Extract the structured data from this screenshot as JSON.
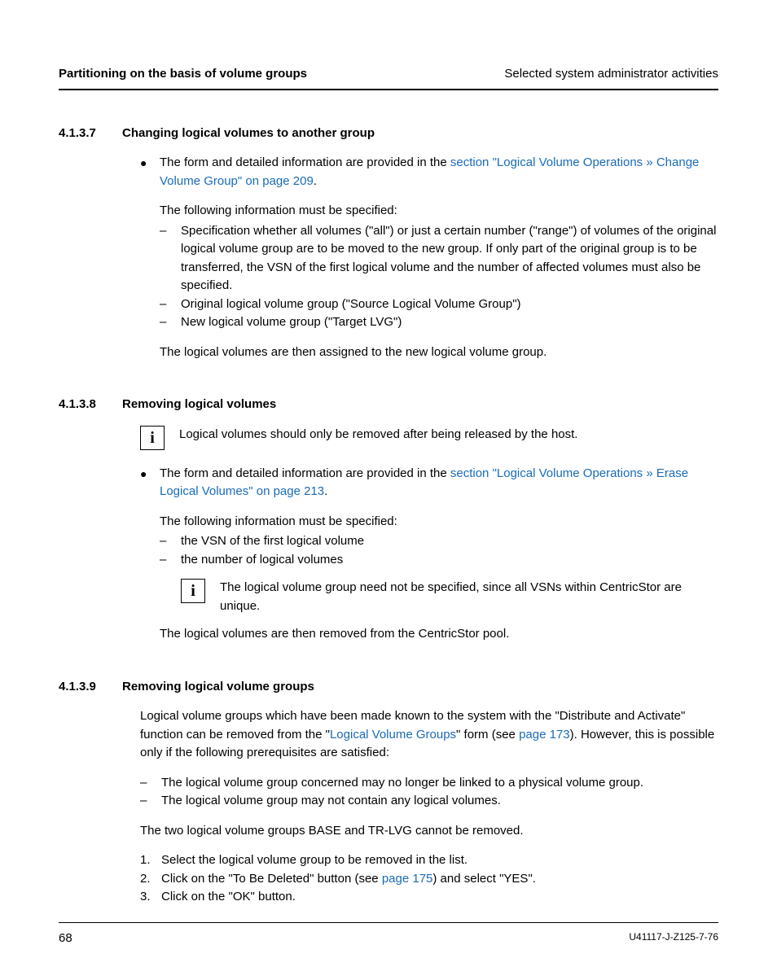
{
  "header": {
    "left": "Partitioning on the basis of volume groups",
    "right": "Selected system administrator activities"
  },
  "s1": {
    "num": "4.1.3.7",
    "title": "Changing logical volumes to another group",
    "bullet_pre": "The form and detailed information are provided in the ",
    "bullet_link": "section \"Logical Volume Operations » Change Volume Group\" on page 209",
    "bullet_post": ".",
    "info_must": "The following information must be specified:",
    "d1": "Specification whether all volumes (\"all\") or just a certain number (\"range\") of volumes of the original logical volume group are to be moved to the new group. If only part of the original group is to be transferred, the VSN of the first logical volume and the number of affected volumes must also be specified.",
    "d2": "Original logical volume group  (\"Source Logical Volume Group\")",
    "d3": "New logical volume group  (\"Target LVG\")",
    "result": "The logical volumes are then assigned to the new logical volume group."
  },
  "s2": {
    "num": "4.1.3.8",
    "title": "Removing logical volumes",
    "info1": "Logical volumes should only be removed after being released by the host.",
    "bullet_pre": "The form and detailed information are provided in the ",
    "bullet_link": "section \"Logical Volume Operations » Erase Logical Volumes\" on page 213",
    "bullet_post": ".",
    "info_must": "The following information must be specified:",
    "d1": "the VSN of the first logical volume",
    "d2": "the number of logical volumes",
    "info2": "The logical volume group need not be specified, since all VSNs within CentricStor are unique.",
    "result": "The logical volumes are then removed from the CentricStor pool."
  },
  "s3": {
    "num": "4.1.3.9",
    "title": "Removing logical volume groups",
    "p1_pre": "Logical volume groups which have been made known to the system with the \"Distribute and Activate\" function can be removed from the \"",
    "p1_link1": "Logical Volume Groups",
    "p1_mid": "\" form (see ",
    "p1_link2": "page 173",
    "p1_post": "). However, this is possible only if the following prerequisites are satisfied:",
    "d1": "The logical volume group concerned may no longer be linked to a physical volume group.",
    "d2": "The logical volume group may not contain any logical volumes.",
    "p2": "The two logical volume groups BASE and TR-LVG cannot be removed.",
    "n1": "Select the logical volume group to be removed in the list.",
    "n2_pre": "Click on the \"To Be Deleted\" button (see ",
    "n2_link": "page 175",
    "n2_post": ") and select \"YES\".",
    "n3": "Click on the \"OK\" button."
  },
  "footer": {
    "left": "68",
    "right": "U41117-J-Z125-7-76"
  },
  "glyphs": {
    "bullet": "●",
    "dash": "–",
    "info": "i"
  },
  "nums": {
    "n1": "1.",
    "n2": "2.",
    "n3": "3."
  }
}
